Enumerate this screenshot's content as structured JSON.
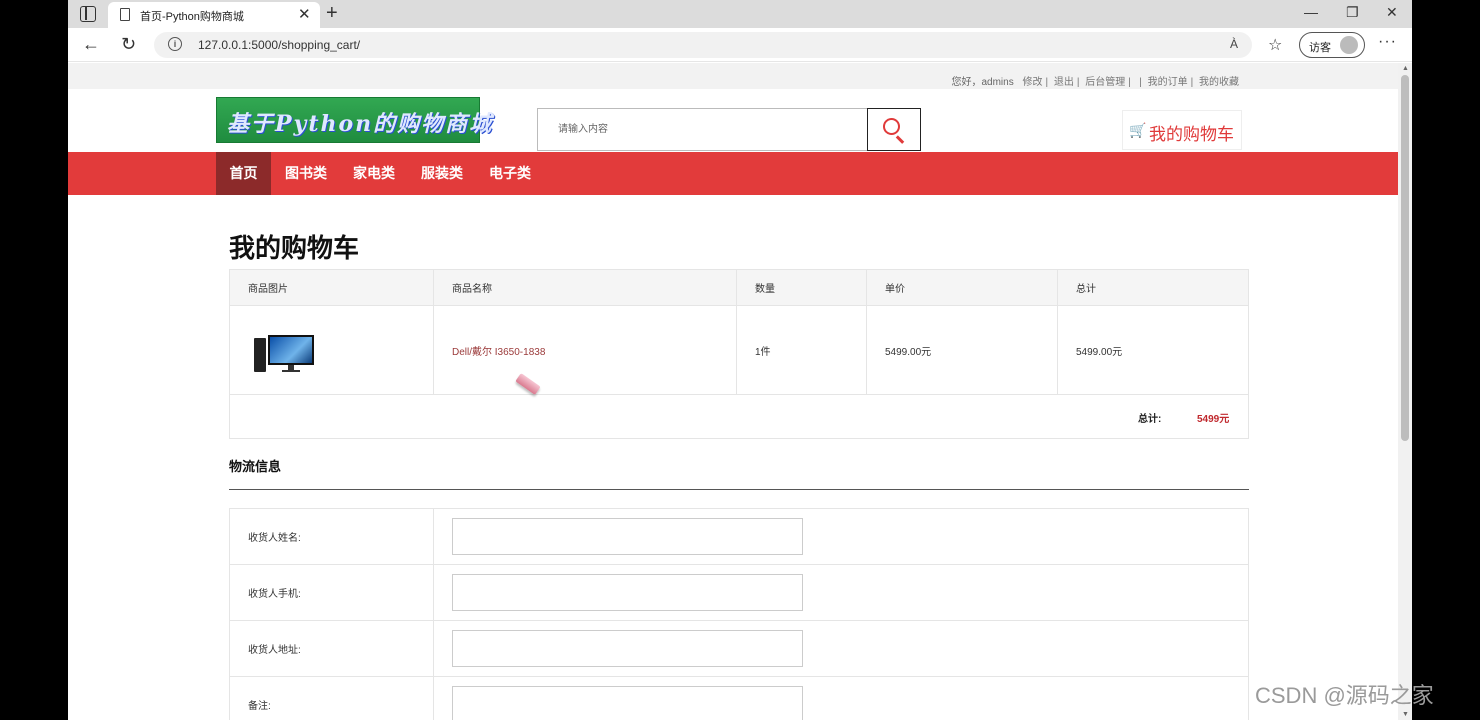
{
  "browser": {
    "tab_title": "首页-Python购物商城",
    "url": "127.0.0.1:5000/shopping_cart/",
    "read_aloud": "À",
    "guest_label": "访客"
  },
  "topbar": {
    "greeting": "您好，admins",
    "edit": "修改",
    "logout": "退出",
    "admin": "后台管理",
    "orders": "我的订单",
    "favorites": "我的收藏"
  },
  "header": {
    "logo_text": "基于Python的购物商城",
    "search_placeholder": "请输入内容",
    "cart_label": "我的购物车"
  },
  "nav": {
    "items": [
      "首页",
      "图书类",
      "家电类",
      "服装类",
      "电子类"
    ],
    "active": "首页"
  },
  "page_title": "我的购物车",
  "cart_table": {
    "headers": [
      "商品图片",
      "商品名称",
      "数量",
      "单价",
      "总计"
    ],
    "rows": [
      {
        "name": "Dell/戴尔 I3650-1838",
        "qty": "1件",
        "unit_price": "5499.00元",
        "subtotal": "5499.00元"
      }
    ],
    "total_label": "总计:",
    "total_value": "5499元"
  },
  "shipping": {
    "title": "物流信息",
    "fields": [
      {
        "label": "收货人姓名:",
        "value": ""
      },
      {
        "label": "收货人手机:",
        "value": ""
      },
      {
        "label": "收货人地址:",
        "value": ""
      },
      {
        "label": "备注:",
        "value": ""
      }
    ]
  },
  "watermark": "CSDN @源码之家",
  "colors": {
    "brand_red": "#e23b3b",
    "nav_active": "#8c2a2a",
    "price_red": "#c0282d"
  }
}
